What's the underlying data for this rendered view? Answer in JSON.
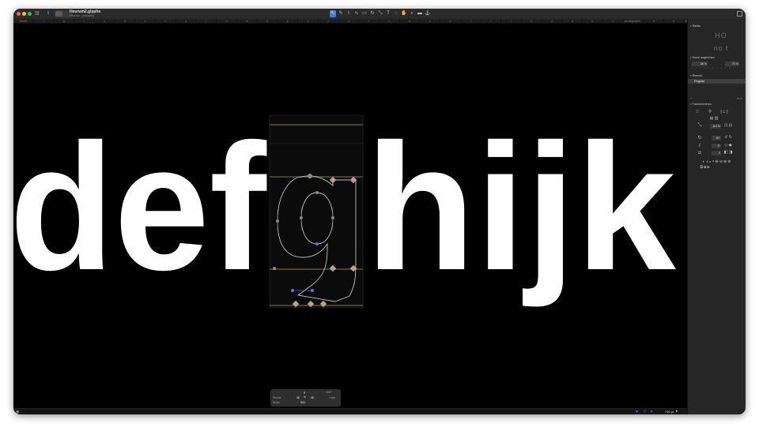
{
  "window": {
    "title": "Heurum2.glyphs",
    "subtitle": "Heurum - [Variable]"
  },
  "toolbar": {
    "tools": [
      {
        "name": "select-tool",
        "icon": "arrow-icon",
        "glyph": "↖",
        "active": true
      },
      {
        "name": "draw-tool",
        "icon": "pen-icon",
        "glyph": "✎",
        "active": false
      },
      {
        "name": "knife-tool",
        "icon": "knife-icon",
        "glyph": "⌇",
        "active": false
      },
      {
        "name": "curve-tool",
        "icon": "curve-icon",
        "glyph": "∿",
        "active": false
      },
      {
        "name": "rectangle-tool",
        "icon": "rectangle-icon",
        "glyph": "▭",
        "active": false
      },
      {
        "name": "rotate-tool",
        "icon": "rotate-icon",
        "glyph": "↻",
        "active": false
      },
      {
        "name": "scale-tool",
        "icon": "scale-icon",
        "glyph": "⤡",
        "active": false
      },
      {
        "name": "text-tool",
        "icon": "text-icon",
        "glyph": "T",
        "active": false
      },
      {
        "name": "annotation-tool",
        "icon": "speech-bubble-icon",
        "glyph": "◌",
        "active": false
      },
      {
        "name": "hand-tool",
        "icon": "hand-icon",
        "glyph": "✋",
        "active": false
      },
      {
        "name": "zoom-tool",
        "icon": "magnifier-icon",
        "glyph": "⌕",
        "active": false
      },
      {
        "name": "measure-tool",
        "icon": "ruler-icon",
        "glyph": "▬",
        "active": false
      },
      {
        "name": "anchor-tool",
        "icon": "anchor-icon",
        "glyph": "⚓",
        "active": false
      }
    ]
  },
  "tabs": [
    "Schrift",
    "i",
    "g",
    "i",
    "c",
    "b",
    "e",
    "h",
    "k",
    "l",
    "n",
    "m",
    "o",
    "p",
    "q",
    "r",
    "s",
    "t",
    "u",
    "a",
    "c",
    "e",
    "f",
    "i",
    "l",
    "n",
    "o",
    "a",
    "b",
    "c",
    "abcdefghijklm...",
    "a",
    "b",
    "ABCDEFGHIJ...",
    "abcdefghijklm...",
    "abcdefghijklm..."
  ],
  "active_tab_index": 35,
  "canvas": {
    "text": "defghijklm",
    "active_glyph": "g"
  },
  "panel": {
    "media_label": "Media",
    "preview_top": "HO",
    "preview_bottom": "no t",
    "curve_label": "Kurve angleichen",
    "curve_left": "58 %",
    "curve_right": "75 %",
    "masters_label": "Ebenen",
    "master_name": "Regular",
    "transform_label": "Transformieren",
    "scale_value": "110 %",
    "rotate_value": "90°",
    "slant_value": "5°",
    "skew_value": "0"
  },
  "stats": {
    "glyph_name": "g",
    "unicode": "0067",
    "left_sb": "38",
    "right_sb": "35",
    "width": "534",
    "left_label": "Rechts",
    "right_label": "Links",
    "width_label": "Breite"
  },
  "status": {
    "zoom": "730 pt"
  }
}
